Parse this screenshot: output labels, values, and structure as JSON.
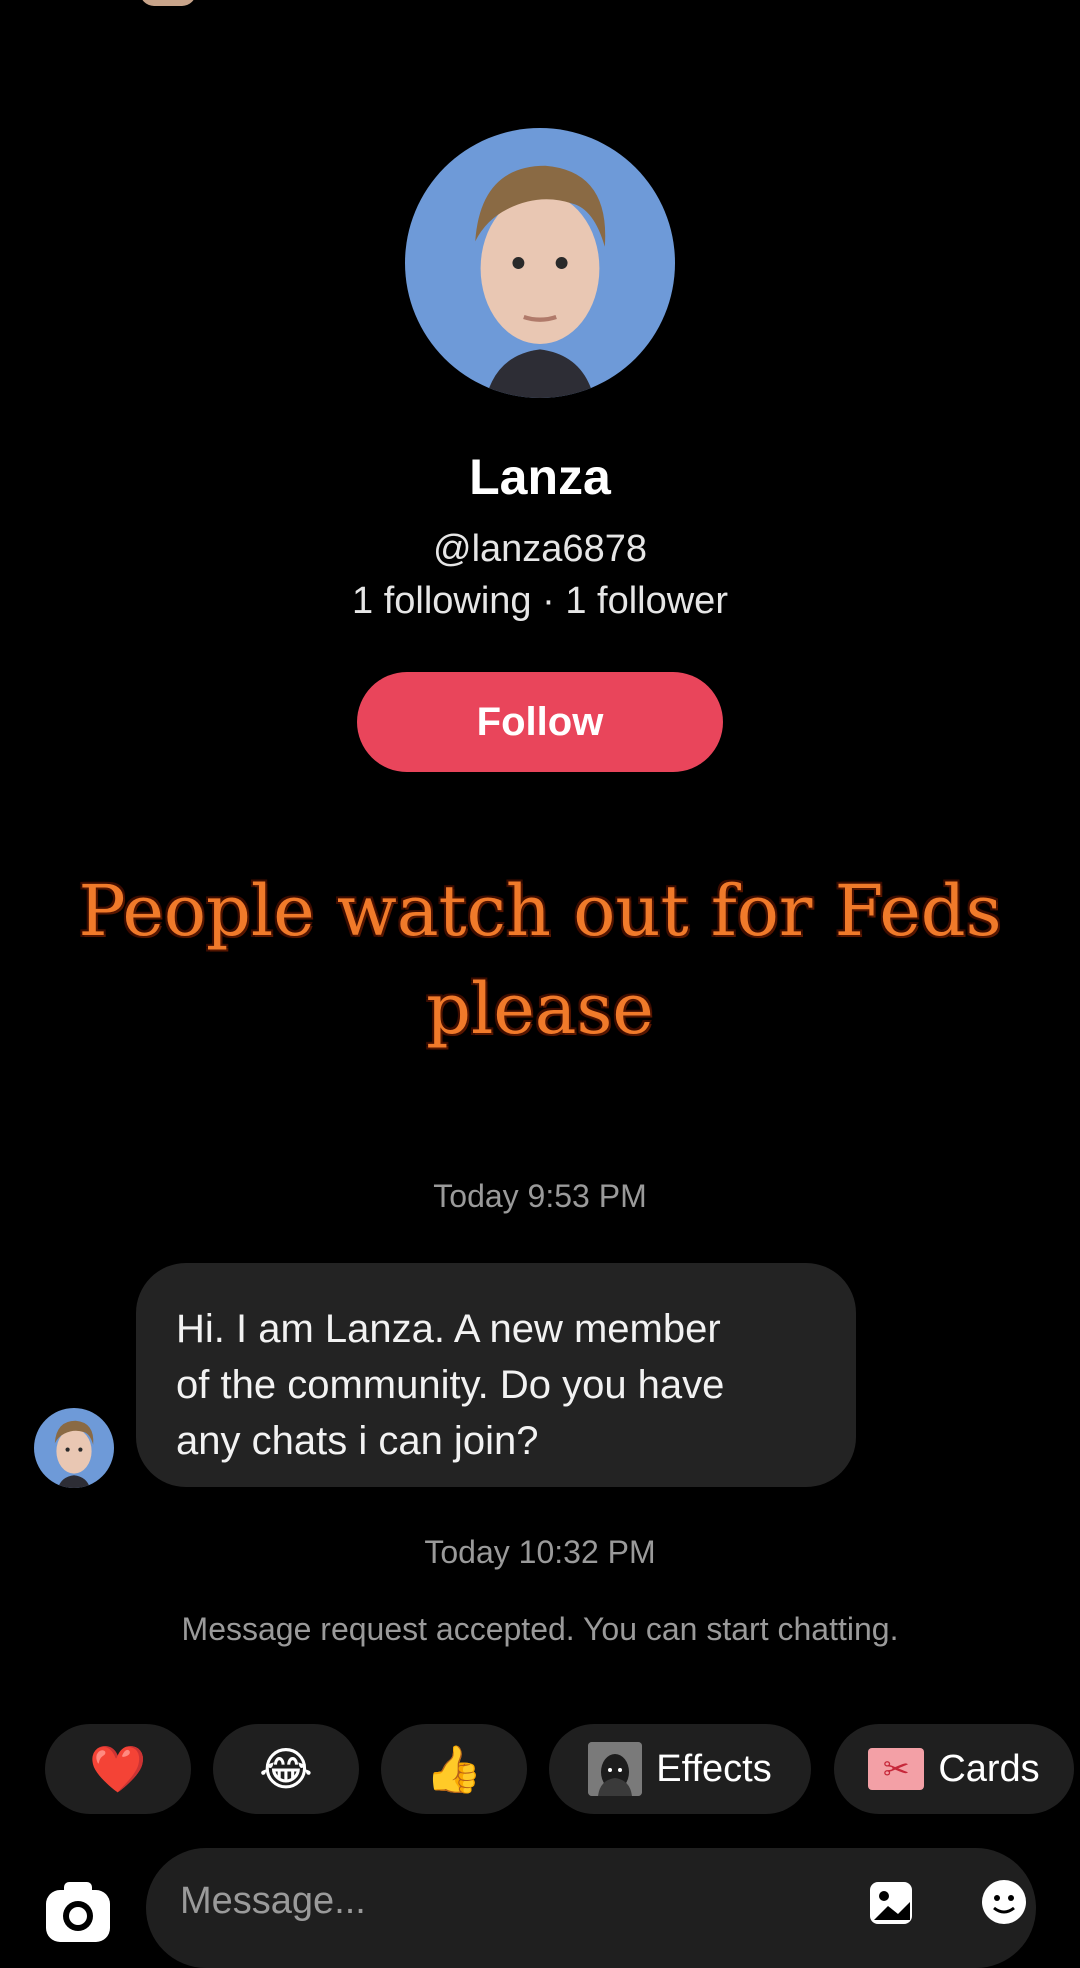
{
  "profile": {
    "name": "Lanza",
    "handle": "@lanza6878",
    "stats": "1 following · 1 follower",
    "follow_label": "Follow"
  },
  "overlay_caption": "People watch out for Feds please",
  "conversation": {
    "first_timestamp": "Today 9:53 PM",
    "message": "Hi. I am Lanza. A new member\nof the community. Do you have\nany chats i can join?",
    "second_timestamp": "Today 10:32 PM",
    "notice": "Message request accepted. You can start chatting."
  },
  "quick_actions": {
    "heart": "❤️",
    "laugh": "😂",
    "thumbs": "👍",
    "effects_label": "Effects",
    "cards_label": "Cards"
  },
  "composer": {
    "placeholder": "Message..."
  },
  "colors": {
    "background": "#000000",
    "follow_button": "#e9455b",
    "bubble": "#232323",
    "chip": "#1f1f1f",
    "muted_text": "#9a9a9a",
    "caption": "#f07a2a"
  },
  "icons": [
    "camera-icon",
    "gallery-icon",
    "sticker-icon",
    "microphone-icon",
    "heart-icon",
    "laugh-icon",
    "thumbs-up-icon",
    "effects-icon",
    "cards-icon"
  ]
}
